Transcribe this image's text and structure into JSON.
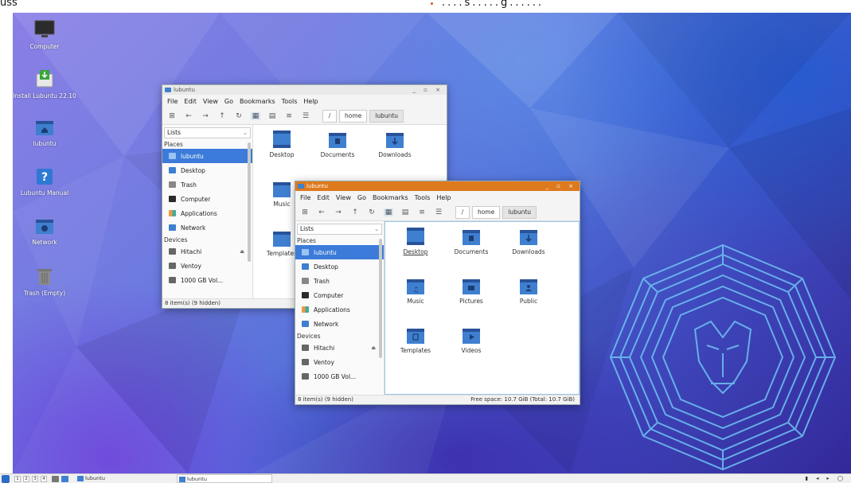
{
  "top_strip": {
    "left_text": "uss",
    "right_text": "....s.....g......"
  },
  "desktop_icons": [
    {
      "label": "Computer",
      "icon": "monitor-icon"
    },
    {
      "label": "Install Lubuntu 22.10",
      "icon": "install-icon"
    },
    {
      "label": "lubuntu",
      "icon": "home-folder-icon"
    },
    {
      "label": "Lubuntu Manual",
      "icon": "help-icon"
    },
    {
      "label": "Network",
      "icon": "network-folder-icon"
    },
    {
      "label": "Trash (Empty)",
      "icon": "trash-icon"
    }
  ],
  "window_back": {
    "title": "lubuntu",
    "controls": "_ ▫ ×",
    "menu": [
      "File",
      "Edit",
      "View",
      "Go",
      "Bookmarks",
      "Tools",
      "Help"
    ],
    "path_root": "/",
    "path": [
      "home",
      "lubuntu"
    ],
    "side_combo": "Lists",
    "places_header": "Places",
    "places": [
      "lubuntu",
      "Desktop",
      "Trash",
      "Computer",
      "Applications",
      "Network"
    ],
    "devices_header": "Devices",
    "devices": [
      "Hitachi",
      "Ventoy",
      "1000 GB Vol..."
    ],
    "files": [
      "Desktop",
      "Documents",
      "Downloads",
      "Music",
      "Templates"
    ],
    "status": "8 item(s) (9 hidden)"
  },
  "window_front": {
    "title": "lubuntu",
    "controls": "_ ▫ ×",
    "menu": [
      "File",
      "Edit",
      "View",
      "Go",
      "Bookmarks",
      "Tools",
      "Help"
    ],
    "path_root": "/",
    "path": [
      "home",
      "lubuntu"
    ],
    "side_combo": "Lists",
    "places_header": "Places",
    "places": [
      "lubuntu",
      "Desktop",
      "Trash",
      "Computer",
      "Applications",
      "Network"
    ],
    "devices_header": "Devices",
    "devices": [
      "Hitachi",
      "Ventoy",
      "1000 GB Vol..."
    ],
    "files": [
      "Desktop",
      "Documents",
      "Downloads",
      "Music",
      "Pictures",
      "Public",
      "Templates",
      "Videos"
    ],
    "status": "8 item(s) (9 hidden)",
    "free_space": "Free space: 10.7 GiB (Total: 10.7 GiB)"
  },
  "taskbar": {
    "workspaces": [
      "1",
      "2",
      "3",
      "4"
    ],
    "tasks": [
      "lubuntu",
      "lubuntu"
    ],
    "tray": "▮ ◂ ▸ ◯"
  },
  "colors": {
    "accent": "#3c7bd9",
    "active_titlebar": "#de7a1e",
    "folder": "#3f7fd0",
    "folder_dark": "#28539a"
  }
}
